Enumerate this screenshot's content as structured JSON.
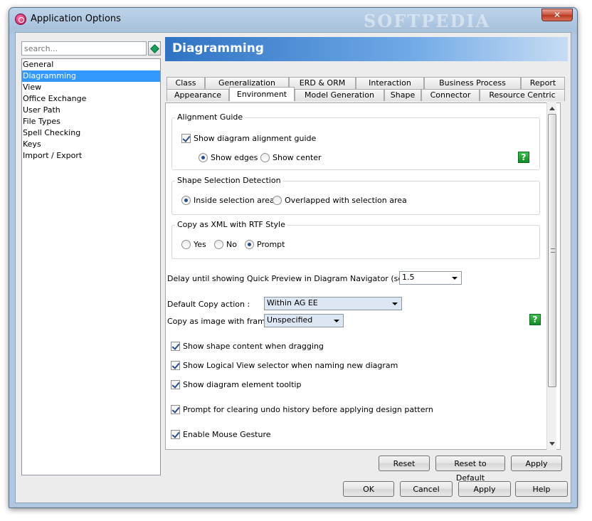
{
  "window": {
    "title": "Application Options",
    "watermark": "SOFTPEDIA",
    "close_glyph": "✕"
  },
  "search": {
    "placeholder": "search..."
  },
  "nav": {
    "items": [
      "General",
      "Diagramming",
      "View",
      "Office Exchange",
      "User Path",
      "File Types",
      "Spell Checking",
      "Keys",
      "Import / Export"
    ],
    "selected": "Diagramming"
  },
  "header": {
    "title": "Diagramming"
  },
  "tabs": {
    "row1": [
      "Class",
      "Generalization",
      "ERD & ORM",
      "Interaction",
      "Business Process",
      "Report"
    ],
    "row2": [
      "Appearance",
      "Environment",
      "Model Generation",
      "Shape",
      "Connector",
      "Resource Centric"
    ],
    "active": "Environment"
  },
  "alignment_guide": {
    "title": "Alignment Guide",
    "show_guide": {
      "label": "Show diagram alignment guide",
      "checked": true
    },
    "show_edges": {
      "label": "Show edges",
      "selected": true
    },
    "show_center": {
      "label": "Show center",
      "selected": false
    }
  },
  "shape_selection": {
    "title": "Shape Selection Detection",
    "inside": {
      "label": "Inside selection area",
      "selected": true
    },
    "overlapped": {
      "label": "Overlapped with selection area",
      "selected": false
    }
  },
  "copy_xml": {
    "title": "Copy as XML with RTF Style",
    "yes": {
      "label": "Yes",
      "selected": false
    },
    "no": {
      "label": "No",
      "selected": false
    },
    "prompt": {
      "label": "Prompt",
      "selected": true
    }
  },
  "delay": {
    "label": "Delay until showing Quick Preview in Diagram Navigator (seconds) :",
    "value": "1.5"
  },
  "default_copy": {
    "label": "Default Copy action :",
    "value": "Within AG EE"
  },
  "copy_image": {
    "label": "Copy as image with frame :",
    "value": "Unspecified"
  },
  "checks": {
    "shape_content": {
      "label": "Show shape content when dragging",
      "checked": true
    },
    "logical_view": {
      "label": "Show Logical View selector when naming new diagram",
      "checked": true
    },
    "element_tooltip": {
      "label": "Show diagram element tooltip",
      "checked": true
    },
    "clear_undo": {
      "label": "Prompt for clearing undo history before applying design pattern",
      "checked": true
    },
    "mouse_gesture": {
      "label": "Enable Mouse Gesture",
      "checked": true
    }
  },
  "help_glyph": "?",
  "buttons": {
    "reset": "Reset",
    "reset_default": "Reset to Default",
    "apply_panel": "Apply",
    "ok": "OK",
    "cancel": "Cancel",
    "apply": "Apply",
    "help": "Help"
  }
}
